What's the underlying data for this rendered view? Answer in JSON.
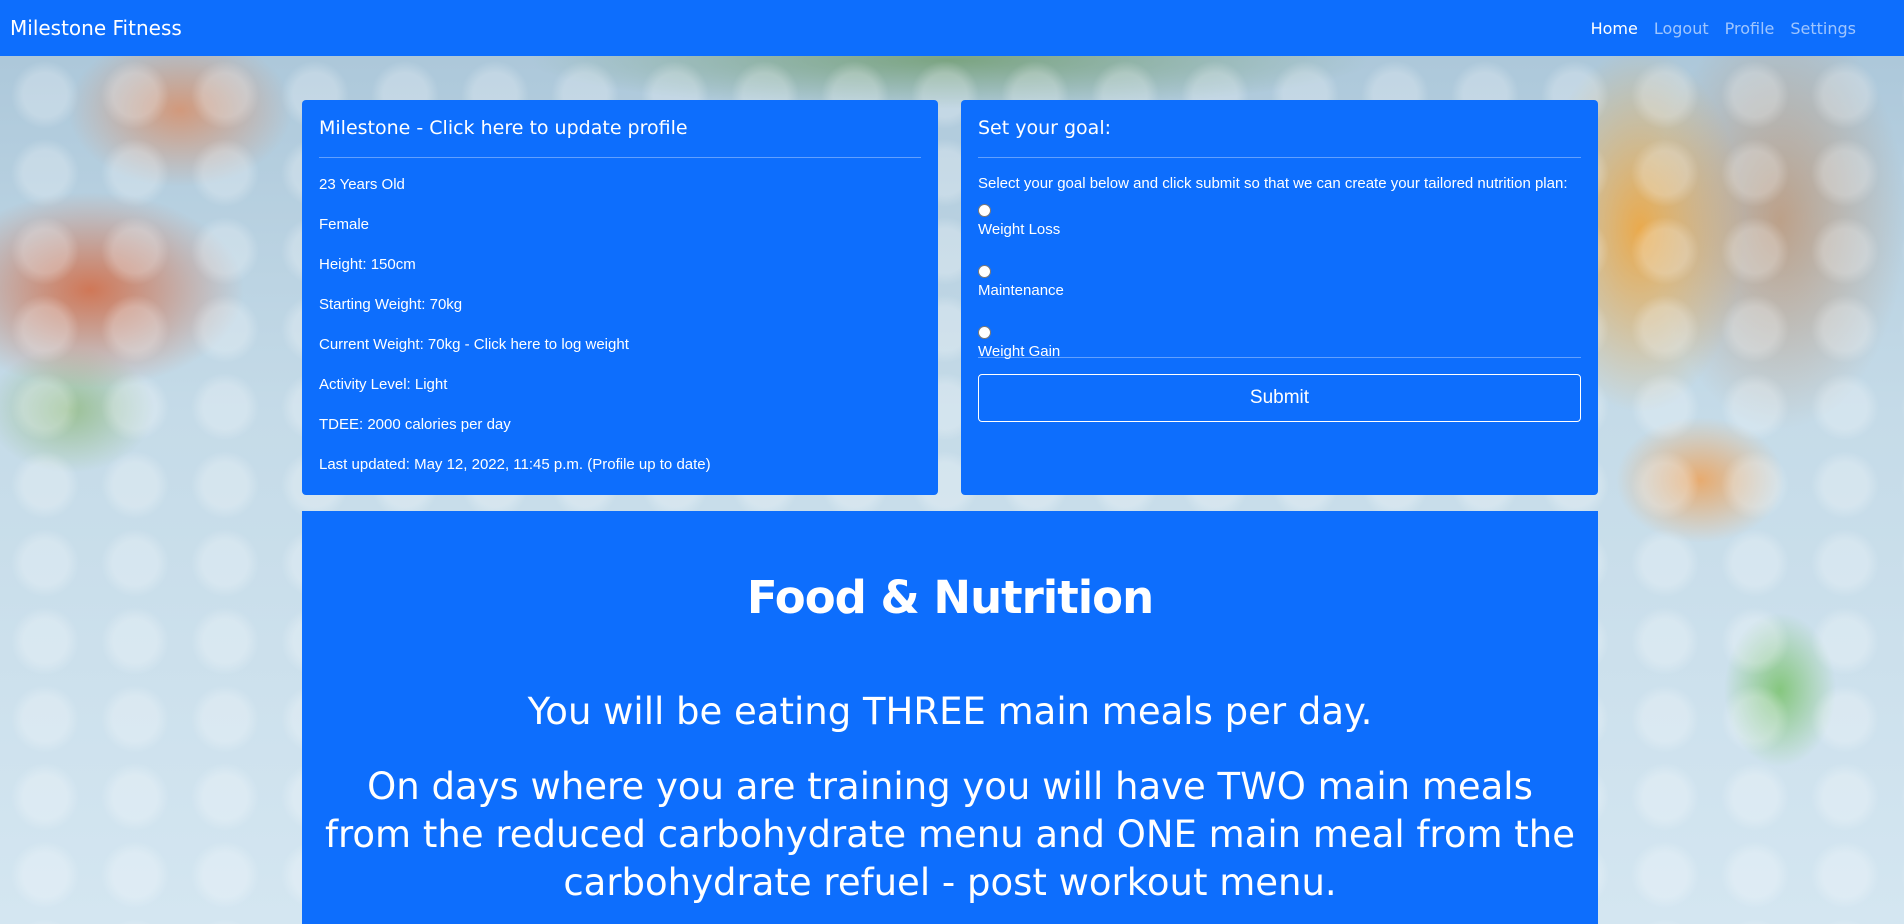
{
  "navbar": {
    "brand": "Milestone Fitness",
    "links": [
      "Home",
      "Logout",
      "Profile",
      "Settings"
    ]
  },
  "profile_card": {
    "title": "Milestone - Click here to update profile",
    "lines": [
      "23 Years Old",
      "Female",
      "Height: 150cm",
      "Starting Weight: 70kg",
      "Current Weight: 70kg - Click here to log weight",
      "Activity Level: Light",
      "TDEE: 2000 calories per day",
      "Last updated: May 12, 2022, 11:45 p.m. (Profile up to date)"
    ]
  },
  "goal_card": {
    "title": "Set your goal:",
    "intro": "Select your goal below and click submit so that we can create your tailored nutrition plan:",
    "options": [
      "Weight Loss",
      "Maintenance",
      "Weight Gain"
    ],
    "submit_label": "Submit"
  },
  "nutrition": {
    "heading": "Food & Nutrition",
    "meals_text": "You will be eating THREE main meals per day.",
    "training_text": "On days where you are training you will have TWO main meals from the reduced carbohydrate menu and ONE main meal from the carbohydrate refuel - post workout menu."
  },
  "colors": {
    "primary": "#0d6efd",
    "text": "#ffffff"
  }
}
